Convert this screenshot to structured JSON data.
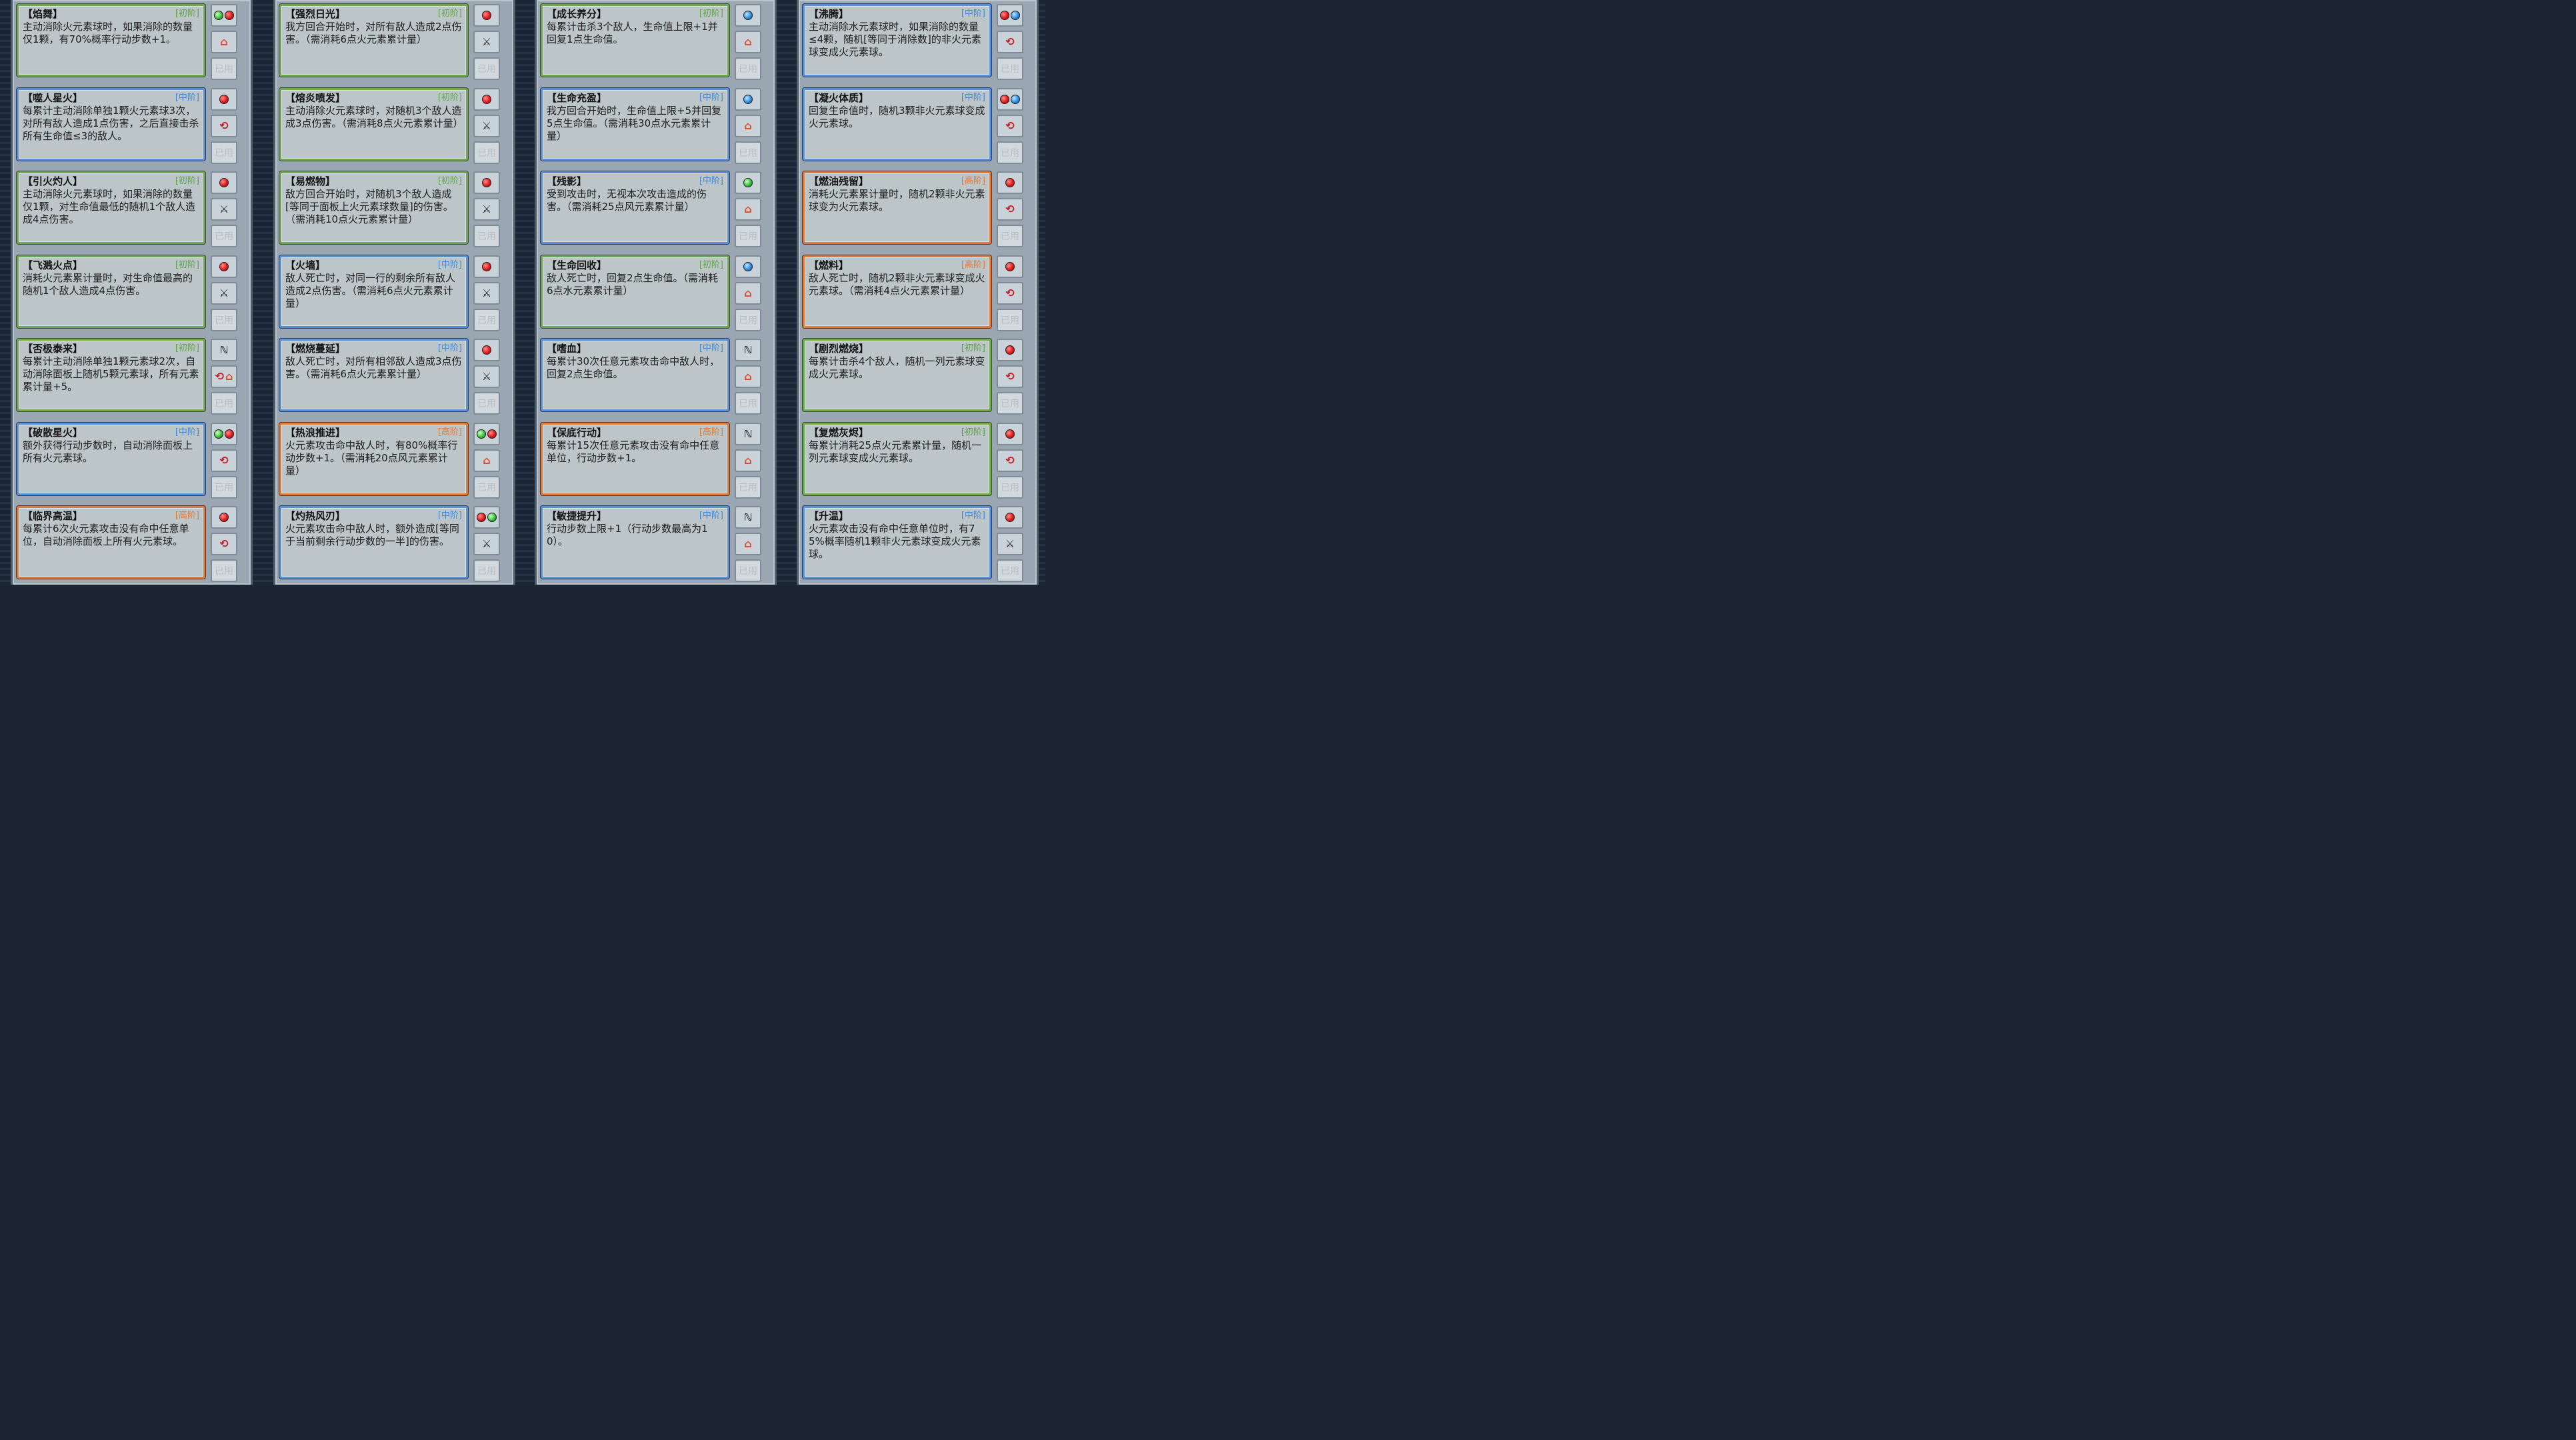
{
  "used_label": "已用",
  "columns": [
    {
      "cards": [
        {
          "name": "【焰舞】",
          "tier": "[初阶]",
          "level": "low",
          "desc": "主动消除火元素球时，如果消除的数量仅1颗，有70%概率行动步数+1。",
          "orbs": [
            "wind",
            "fire"
          ],
          "effect": "house-icon",
          "effect_glyph": "⌂"
        },
        {
          "name": "【噬人星火】",
          "tier": "[中阶]",
          "level": "mid",
          "desc": "每累计主动消除单独1颗火元素球3次，对所有敌人造成1点伤害，之后直接击杀所有生命值≤3的敌人。",
          "orbs": [
            "fire"
          ],
          "effect": "cycle-icon",
          "effect_glyph": "⟲"
        },
        {
          "name": "【引火灼人】",
          "tier": "[初阶]",
          "level": "low",
          "desc": "主动消除火元素球时，如果消除的数量仅1颗，对生命值最低的随机1个敌人造成4点伤害。",
          "orbs": [
            "fire"
          ],
          "effect": "sword-icon",
          "effect_glyph": "⚔"
        },
        {
          "name": "【飞溅火点】",
          "tier": "[初阶]",
          "level": "low",
          "desc": "消耗火元素累计量时，对生命值最高的随机1个敌人造成4点伤害。",
          "orbs": [
            "fire"
          ],
          "effect": "sword-icon",
          "effect_glyph": "⚔"
        },
        {
          "name": "【否极泰来】",
          "tier": "[初阶]",
          "level": "low",
          "desc": "每累计主动消除单独1颗元素球2次，自动消除面板上随机5颗元素球，所有元素累计量+5。",
          "orbs": [],
          "omni": true,
          "effect": "cycle-house-icon",
          "effect_glyph": "⟲⌂"
        },
        {
          "name": "【破散星火】",
          "tier": "[中阶]",
          "level": "mid",
          "desc": "额外获得行动步数时，自动消除面板上所有火元素球。",
          "orbs": [
            "wind",
            "fire"
          ],
          "effect": "cycle-icon",
          "effect_glyph": "⟲"
        },
        {
          "name": "【临界高温】",
          "tier": "[高阶]",
          "level": "high",
          "desc": "每累计6次火元素攻击没有命中任意单位，自动消除面板上所有火元素球。",
          "orbs": [
            "fire"
          ],
          "effect": "cycle-icon",
          "effect_glyph": "⟲"
        }
      ]
    },
    {
      "cards": [
        {
          "name": "【强烈日光】",
          "tier": "[初阶]",
          "level": "low",
          "desc": "我方回合开始时，对所有敌人造成2点伤害。（需消耗6点火元素累计量）",
          "orbs": [
            "fire"
          ],
          "effect": "sword-icon",
          "effect_glyph": "⚔"
        },
        {
          "name": "【熔炎喷发】",
          "tier": "[初阶]",
          "level": "low",
          "desc": "主动消除火元素球时，对随机3个敌人造成3点伤害。（需消耗8点火元素累计量）",
          "orbs": [
            "fire"
          ],
          "effect": "sword-icon",
          "effect_glyph": "⚔"
        },
        {
          "name": "【易燃物】",
          "tier": "[初阶]",
          "level": "low",
          "desc": "敌方回合开始时，对随机3个敌人造成[等同于面板上火元素球数量]的伤害。（需消耗10点火元素累计量）",
          "orbs": [
            "fire"
          ],
          "effect": "sword-icon",
          "effect_glyph": "⚔"
        },
        {
          "name": "【火墙】",
          "tier": "[中阶]",
          "level": "mid",
          "desc": "敌人死亡时，对同一行的剩余所有敌人造成2点伤害。（需消耗6点火元素累计量）",
          "orbs": [
            "fire"
          ],
          "effect": "sword-icon",
          "effect_glyph": "⚔"
        },
        {
          "name": "【燃烧蔓延】",
          "tier": "[中阶]",
          "level": "mid",
          "desc": "敌人死亡时，对所有相邻敌人造成3点伤害。（需消耗6点火元素累计量）",
          "orbs": [
            "fire"
          ],
          "effect": "sword-icon",
          "effect_glyph": "⚔"
        },
        {
          "name": "【热浪推进】",
          "tier": "[高阶]",
          "level": "high",
          "desc": "火元素攻击命中敌人时，有80%概率行动步数+1。（需消耗20点风元素累计量）",
          "orbs": [
            "wind",
            "fire"
          ],
          "effect": "house-icon",
          "effect_glyph": "⌂"
        },
        {
          "name": "【灼热风刃】",
          "tier": "[中阶]",
          "level": "mid",
          "desc": "火元素攻击命中敌人时，额外造成[等同于当前剩余行动步数的一半]的伤害。",
          "orbs": [
            "fire",
            "wind"
          ],
          "effect": "sword-icon",
          "effect_glyph": "⚔"
        }
      ]
    },
    {
      "cards": [
        {
          "name": "【成长养分】",
          "tier": "[初阶]",
          "level": "low",
          "desc": "每累计击杀3个敌人，生命值上限+1并回复1点生命值。",
          "orbs": [
            "water"
          ],
          "effect": "house-icon",
          "effect_glyph": "⌂"
        },
        {
          "name": "【生命充盈】",
          "tier": "[中阶]",
          "level": "mid",
          "desc": "我方回合开始时，生命值上限+5并回复5点生命值。（需消耗30点水元素累计量）",
          "orbs": [
            "water"
          ],
          "effect": "house-icon",
          "effect_glyph": "⌂"
        },
        {
          "name": "【残影】",
          "tier": "[中阶]",
          "level": "mid",
          "desc": "受到攻击时，无视本次攻击造成的伤害。（需消耗25点风元素累计量）",
          "orbs": [
            "wind"
          ],
          "effect": "house-icon",
          "effect_glyph": "⌂"
        },
        {
          "name": "【生命回收】",
          "tier": "[初阶]",
          "level": "low",
          "desc": "敌人死亡时，回复2点生命值。（需消耗6点水元素累计量）",
          "orbs": [
            "water"
          ],
          "effect": "house-icon",
          "effect_glyph": "⌂"
        },
        {
          "name": "【嗜血】",
          "tier": "[中阶]",
          "level": "mid",
          "desc": "每累计30次任意元素攻击命中敌人时，回复2点生命值。",
          "orbs": [],
          "omni": true,
          "effect": "house-icon",
          "effect_glyph": "⌂"
        },
        {
          "name": "【保底行动】",
          "tier": "[高阶]",
          "level": "high",
          "desc": "每累计15次任意元素攻击没有命中任意单位，行动步数+1。",
          "orbs": [],
          "omni": true,
          "effect": "house-icon",
          "effect_glyph": "⌂"
        },
        {
          "name": "【敏捷提升】",
          "tier": "[中阶]",
          "level": "mid",
          "desc": "行动步数上限+1（行动步数最高为10）。",
          "orbs": [],
          "omni": true,
          "effect": "house-icon",
          "effect_glyph": "⌂"
        }
      ]
    },
    {
      "cards": [
        {
          "name": "【沸腾】",
          "tier": "[中阶]",
          "level": "mid",
          "desc": "主动消除水元素球时，如果消除的数量≤4颗，随机[等同于消除数]的非火元素球变成火元素球。",
          "orbs": [
            "fire",
            "water"
          ],
          "effect": "cycle-icon",
          "effect_glyph": "⟲"
        },
        {
          "name": "【凝火体质】",
          "tier": "[中阶]",
          "level": "mid",
          "desc": "回复生命值时，随机3颗非火元素球变成火元素球。",
          "orbs": [
            "fire",
            "water"
          ],
          "effect": "cycle-icon",
          "effect_glyph": "⟲"
        },
        {
          "name": "【燃油残留】",
          "tier": "[高阶]",
          "level": "high",
          "desc": "消耗火元素累计量时，随机2颗非火元素球变为火元素球。",
          "orbs": [
            "fire"
          ],
          "effect": "cycle-icon",
          "effect_glyph": "⟲"
        },
        {
          "name": "【燃料】",
          "tier": "[高阶]",
          "level": "high",
          "desc": "敌人死亡时，随机2颗非火元素球变成火元素球。（需消耗4点火元素累计量）",
          "orbs": [
            "fire"
          ],
          "effect": "cycle-icon",
          "effect_glyph": "⟲"
        },
        {
          "name": "【剧烈燃烧】",
          "tier": "[初阶]",
          "level": "low",
          "desc": "每累计击杀4个敌人，随机一列元素球变成火元素球。",
          "orbs": [
            "fire"
          ],
          "effect": "cycle-icon",
          "effect_glyph": "⟲"
        },
        {
          "name": "【复燃灰烬】",
          "tier": "[初阶]",
          "level": "low",
          "desc": "每累计消耗25点火元素累计量，随机一列元素球变成火元素球。",
          "orbs": [
            "fire"
          ],
          "effect": "cycle-icon",
          "effect_glyph": "⟲"
        },
        {
          "name": "【升温】",
          "tier": "[中阶]",
          "level": "mid",
          "desc": "火元素攻击没有命中任意单位时，有75%概率随机1颗非火元素球变成火元素球。",
          "orbs": [
            "fire"
          ],
          "effect": "sword-icon",
          "effect_glyph": "⚔"
        }
      ]
    }
  ]
}
